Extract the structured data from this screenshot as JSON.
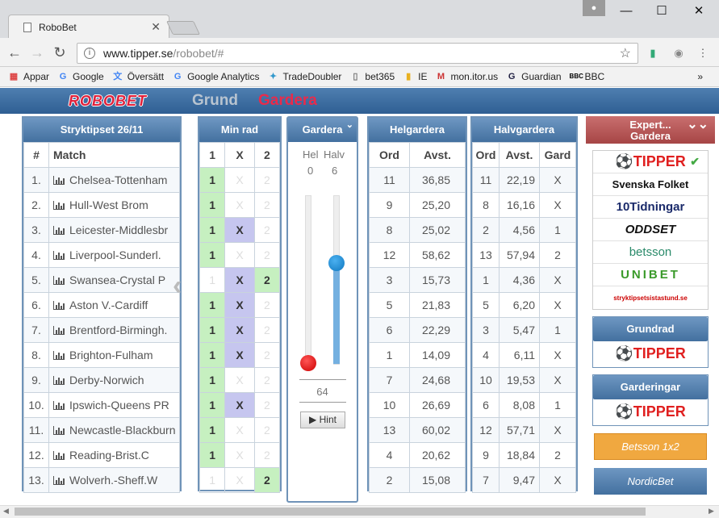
{
  "browser": {
    "tab_title": "RoboBet",
    "url_host": "www.tipper.se",
    "url_path": "/robobet/#",
    "bookmarks": [
      "Appar",
      "Google",
      "Översätt",
      "Google Analytics",
      "TradeDoubler",
      "bet365",
      "IE",
      "mon.itor.us",
      "Guardian",
      "BBC"
    ],
    "more": "»"
  },
  "site": {
    "logo": "ROBOBET",
    "nav_grund": "Grund",
    "nav_gardera": "Gardera"
  },
  "stryktips": {
    "title": "Stryktipset 26/11",
    "col_num": "#",
    "col_match": "Match",
    "matches": [
      {
        "n": "1.",
        "name": "Chelsea-Tottenham"
      },
      {
        "n": "2.",
        "name": "Hull-West Brom"
      },
      {
        "n": "3.",
        "name": "Leicester-Middlesbr"
      },
      {
        "n": "4.",
        "name": "Liverpool-Sunderl."
      },
      {
        "n": "5.",
        "name": "Swansea-Crystal P"
      },
      {
        "n": "6.",
        "name": "Aston V.-Cardiff"
      },
      {
        "n": "7.",
        "name": "Brentford-Birmingh."
      },
      {
        "n": "8.",
        "name": "Brighton-Fulham"
      },
      {
        "n": "9.",
        "name": "Derby-Norwich"
      },
      {
        "n": "10.",
        "name": "Ipswich-Queens PR"
      },
      {
        "n": "11.",
        "name": "Newcastle-Blackburn"
      },
      {
        "n": "12.",
        "name": "Reading-Brist.C"
      },
      {
        "n": "13.",
        "name": "Wolverh.-Sheff.W"
      }
    ]
  },
  "minrad": {
    "title": "Min rad",
    "cols": [
      "1",
      "X",
      "2"
    ],
    "rows": [
      [
        "1",
        "",
        ""
      ],
      [
        "1",
        "",
        ""
      ],
      [
        "1",
        "X",
        ""
      ],
      [
        "1",
        "",
        ""
      ],
      [
        "",
        "X",
        "2"
      ],
      [
        "1",
        "X",
        ""
      ],
      [
        "1",
        "X",
        ""
      ],
      [
        "1",
        "X",
        ""
      ],
      [
        "1",
        "",
        ""
      ],
      [
        "1",
        "X",
        ""
      ],
      [
        "1",
        "",
        ""
      ],
      [
        "1",
        "",
        ""
      ],
      [
        "",
        "",
        "2"
      ]
    ]
  },
  "gardera": {
    "title": "Gardera",
    "hel_label": "Hel",
    "halv_label": "Halv",
    "hel_value": "0",
    "halv_value": "6",
    "rows": "64",
    "hint": "Hint",
    "hel_level": 0,
    "halv_level": 0.6
  },
  "helgardera": {
    "title": "Helgardera",
    "cols": [
      "Ord",
      "Avst."
    ],
    "rows": [
      [
        "11",
        "36,85"
      ],
      [
        "9",
        "25,20"
      ],
      [
        "8",
        "25,02"
      ],
      [
        "12",
        "58,62"
      ],
      [
        "3",
        "15,73"
      ],
      [
        "5",
        "21,83"
      ],
      [
        "6",
        "22,29"
      ],
      [
        "1",
        "14,09"
      ],
      [
        "7",
        "24,68"
      ],
      [
        "10",
        "26,69"
      ],
      [
        "13",
        "60,02"
      ],
      [
        "4",
        "20,62"
      ],
      [
        "2",
        "15,08"
      ]
    ]
  },
  "halvgardera": {
    "title": "Halvgardera",
    "cols": [
      "Ord",
      "Avst.",
      "Gard"
    ],
    "rows": [
      [
        "11",
        "22,19",
        "X"
      ],
      [
        "8",
        "16,16",
        "X"
      ],
      [
        "2",
        "4,56",
        "1"
      ],
      [
        "13",
        "57,94",
        "2"
      ],
      [
        "1",
        "4,36",
        "X"
      ],
      [
        "5",
        "6,20",
        "X"
      ],
      [
        "3",
        "5,47",
        "1"
      ],
      [
        "4",
        "6,11",
        "X"
      ],
      [
        "10",
        "19,53",
        "X"
      ],
      [
        "6",
        "8,08",
        "1"
      ],
      [
        "12",
        "57,71",
        "X"
      ],
      [
        "9",
        "18,84",
        "2"
      ],
      [
        "7",
        "9,47",
        "X"
      ]
    ]
  },
  "expert": {
    "title": "Expert...",
    "subtitle": "Gardera",
    "sources": [
      "TIPPER",
      "Svenska Folket",
      "10Tidningar",
      "ODDSET",
      "betsson",
      "UNIBET",
      "stryktipsetsistastund.se"
    ],
    "grundrad": "Grundrad",
    "garderingar": "Garderingar",
    "tipper": "TIPPER",
    "betsson_btn": "Betsson 1x2",
    "nordicbet_btn": "NordicBet"
  },
  "colors": {
    "header_blue": "#43709f",
    "accent_red": "#ea2a4a",
    "pick_green": "#c6f0c0",
    "pick_purple": "#c6c6ef"
  }
}
